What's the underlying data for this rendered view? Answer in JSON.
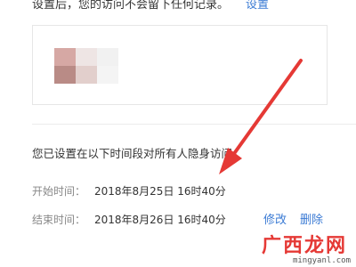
{
  "header": {
    "notice_text": "设置后，您的访问不会留下任何记录。",
    "settings_link": "设置"
  },
  "invisible_period": {
    "notice": "您已设置在以下时间段对所有人隐身访问",
    "start_label": "开始时间：",
    "start_value": "2018年8月25日 16时40分",
    "end_label": "结束时间：",
    "end_value": "2018年8月26日 16时40分",
    "edit_label": "修改",
    "delete_label": "删除"
  },
  "watermark": {
    "logo_text": "广西龙网",
    "url": "mingyanl.com"
  },
  "colors": {
    "link": "#3b7bd4",
    "annotation_arrow": "#e53935"
  }
}
